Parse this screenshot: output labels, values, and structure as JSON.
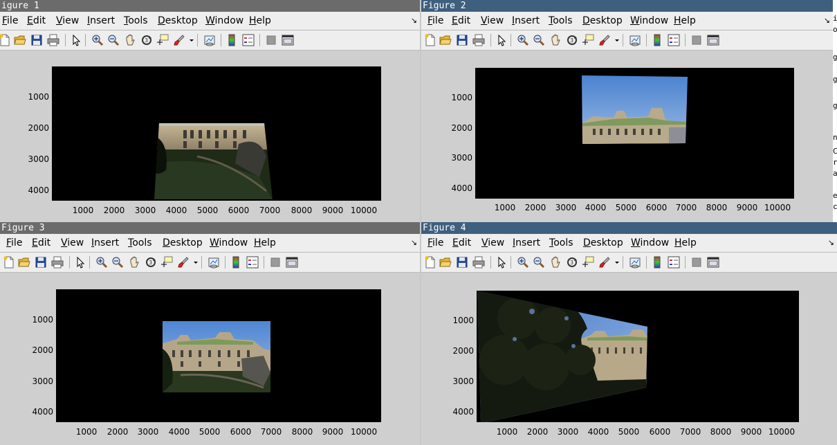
{
  "menu_items": [
    "File",
    "Edit",
    "View",
    "Insert",
    "Tools",
    "Desktop",
    "Window",
    "Help"
  ],
  "menu_underline": [
    "F",
    "E",
    "V",
    "I",
    "T",
    "D",
    "W",
    "H"
  ],
  "menu_rest": [
    "ile",
    "dit",
    "iew",
    "nsert",
    "ools",
    "esktop",
    "indow",
    "elp"
  ],
  "toolbar_icons": [
    "new-figure-icon",
    "open-file-icon",
    "save-icon",
    "print-icon",
    "pointer-icon",
    "zoom-in-icon",
    "zoom-out-icon",
    "pan-hand-icon",
    "rotate-3d-icon",
    "data-cursor-icon",
    "brush-icon",
    "brush-dropdown-icon",
    "link-plot-icon",
    "colorbar-icon",
    "legend-icon",
    "hide-plot-tools-icon",
    "show-plot-tools-icon"
  ],
  "figures": [
    {
      "title": "igure 1",
      "active": false
    },
    {
      "title": "Figure 2",
      "active": true
    },
    {
      "title": "Figure 3",
      "active": false
    },
    {
      "title": "Figure 4",
      "active": true
    }
  ],
  "axes": {
    "xticks": [
      "1000",
      "2000",
      "3000",
      "4000",
      "5000",
      "6000",
      "7000",
      "8000",
      "9000",
      "10000"
    ],
    "yticks": [
      "1000",
      "2000",
      "3000",
      "4000"
    ]
  },
  "right_edge_chars": [
    "i",
    "o",
    "g",
    "g",
    "g",
    "n",
    "C",
    "r",
    "a",
    "e",
    "c"
  ],
  "colors": {
    "title_active": "#3f5f7f",
    "title_inactive": "#6b6b6b",
    "sky": "#5a8fd6",
    "stone": "#b3a68d",
    "plot_bg": "#000000"
  }
}
